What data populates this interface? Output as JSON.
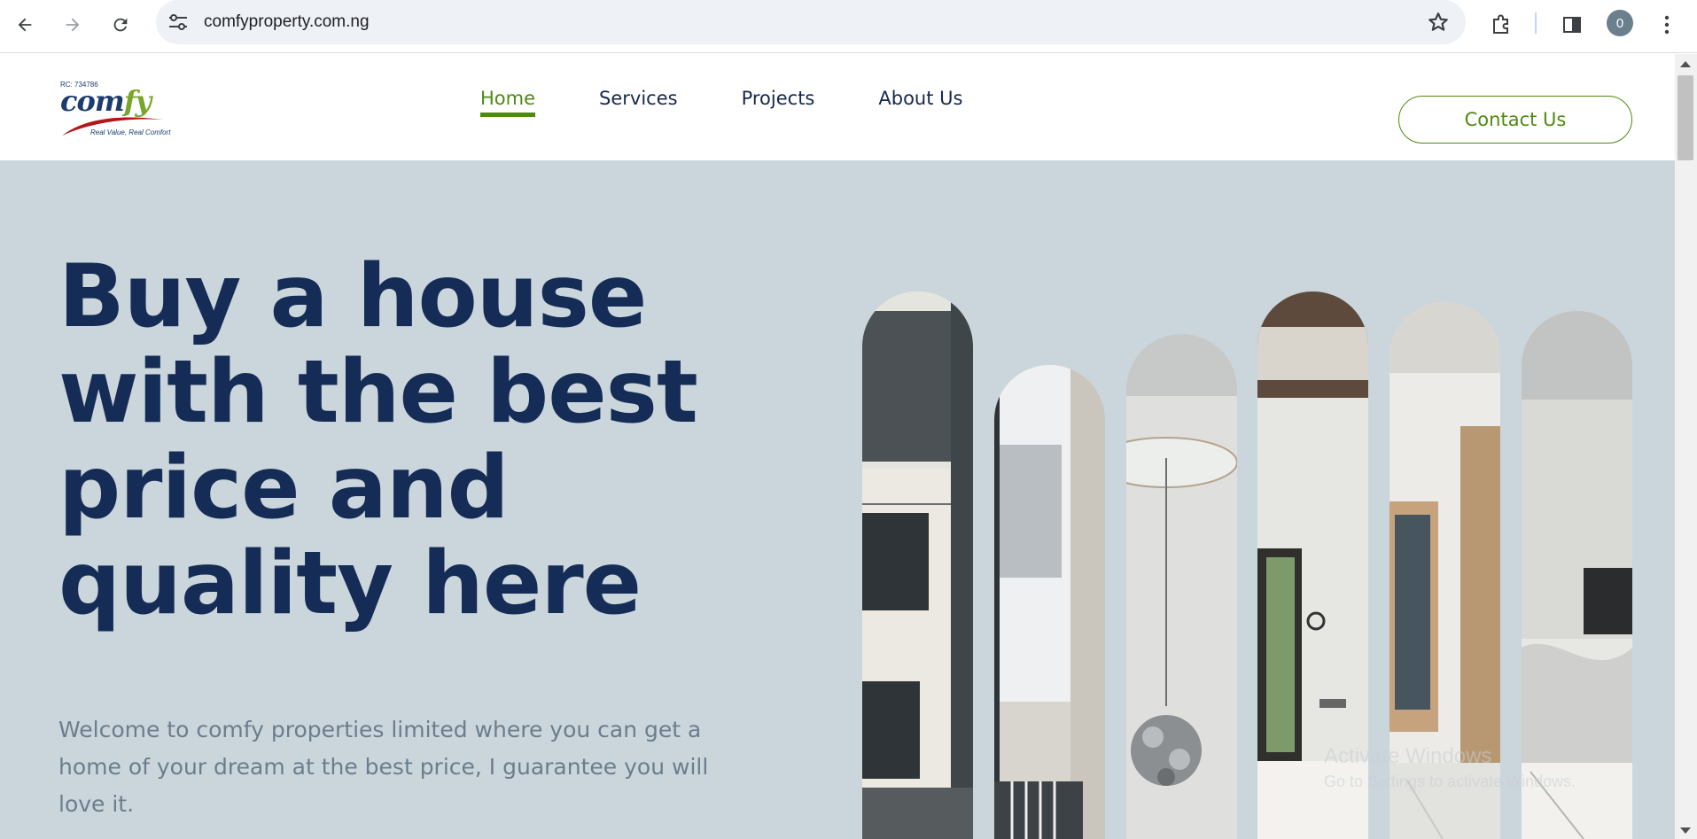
{
  "browser": {
    "url": "comfyproperty.com.ng",
    "profile_initial": "0"
  },
  "site": {
    "logo": {
      "rc": "RC: 734786",
      "word_main": "com",
      "word_accent": "fy",
      "tagline": "Real Value, Real Comfort"
    },
    "nav": [
      {
        "label": "Home",
        "active": true
      },
      {
        "label": "Services",
        "active": false
      },
      {
        "label": "Projects",
        "active": false
      },
      {
        "label": "About Us",
        "active": false
      }
    ],
    "contact_label": "Contact Us"
  },
  "hero": {
    "headline": "Buy a house with the best price and quality here",
    "intro": "Welcome to comfy properties limited where you can get a home of your dream at the best price, I guarantee you will love it.",
    "photos": [
      {
        "name": "building-exterior"
      },
      {
        "name": "balcony-view"
      },
      {
        "name": "chandelier-ceiling"
      },
      {
        "name": "room-window"
      },
      {
        "name": "hallway-doors"
      },
      {
        "name": "kitchen-counter"
      }
    ]
  },
  "watermark": {
    "line1": "Activate Windows",
    "line2": "Go to Settings to activate Windows."
  },
  "colors": {
    "brand_green": "#4f8a10",
    "navy": "#152d56",
    "hero_bg": "#cbd6dc"
  }
}
